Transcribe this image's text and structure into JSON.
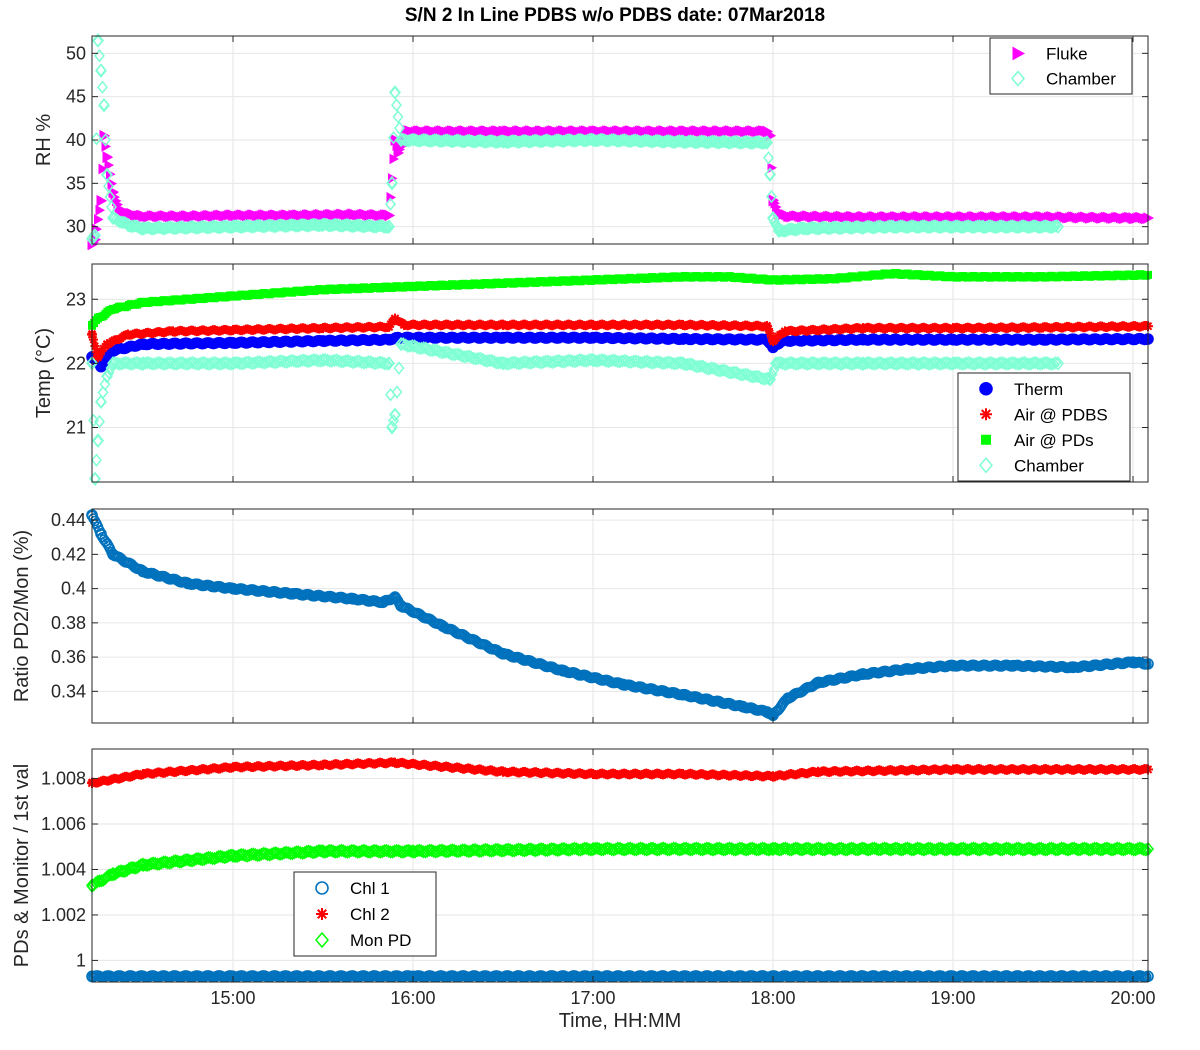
{
  "figure": {
    "title": "S/N 2 In Line PDBS w/o PDBS date: 07Mar2018",
    "xlabel": "Time, HH:MM"
  },
  "colors": {
    "magenta": "#ff00ff",
    "aqua": "#7fffd4",
    "blue": "#0000ff",
    "red": "#ff0000",
    "green": "#00ff00",
    "steelblue": "#0072bd",
    "grid": "#e6e6e6",
    "axis": "#262626"
  },
  "chart_data": [
    {
      "type": "scatter",
      "ylabel": "RH %",
      "ylim": [
        28,
        52
      ],
      "xlim": [
        "14:13",
        "20:05"
      ],
      "y_ticks": [
        30,
        35,
        40,
        45,
        50
      ],
      "grid": true,
      "legend_position": "top-right",
      "series": [
        {
          "name": "Fluke",
          "marker": "triangle-right",
          "color": "magenta",
          "points": [
            [
              "14:13",
              28
            ],
            [
              "14:14",
              28.5
            ],
            [
              "14:16",
              33
            ],
            [
              "14:17",
              40.5
            ],
            [
              "14:18",
              38
            ],
            [
              "14:20",
              34
            ],
            [
              "14:22",
              32
            ],
            [
              "14:25",
              31.5
            ],
            [
              "14:30",
              31.2
            ],
            [
              "14:45",
              31.2
            ],
            [
              "15:00",
              31.3
            ],
            [
              "15:20",
              31.3
            ],
            [
              "15:40",
              31.4
            ],
            [
              "15:52",
              31.3
            ],
            [
              "15:54",
              40
            ],
            [
              "15:55",
              38.5
            ],
            [
              "15:58",
              41
            ],
            [
              "16:30",
              41
            ],
            [
              "17:00",
              41
            ],
            [
              "17:30",
              41
            ],
            [
              "17:58",
              41
            ],
            [
              "17:59",
              40.5
            ],
            [
              "18:00",
              33
            ],
            [
              "18:02",
              31.5
            ],
            [
              "18:05",
              31.2
            ],
            [
              "18:30",
              31.1
            ],
            [
              "19:00",
              31.1
            ],
            [
              "19:30",
              31.1
            ],
            [
              "20:00",
              31
            ],
            [
              "20:05",
              31
            ]
          ]
        },
        {
          "name": "Chamber",
          "marker": "diamond",
          "color": "aqua",
          "points": [
            [
              "14:13",
              28.6
            ],
            [
              "14:14",
              29
            ],
            [
              "14:15",
              51.5
            ],
            [
              "14:16",
              48
            ],
            [
              "14:17",
              44
            ],
            [
              "14:18",
              36
            ],
            [
              "14:20",
              31
            ],
            [
              "14:25",
              30.2
            ],
            [
              "14:30",
              29.8
            ],
            [
              "15:00",
              30
            ],
            [
              "15:30",
              30.2
            ],
            [
              "15:52",
              30
            ],
            [
              "15:53",
              35
            ],
            [
              "15:54",
              45.5
            ],
            [
              "15:56",
              40
            ],
            [
              "16:30",
              39.8
            ],
            [
              "17:00",
              40
            ],
            [
              "17:30",
              39.8
            ],
            [
              "17:58",
              39.7
            ],
            [
              "17:59",
              36
            ],
            [
              "18:00",
              31
            ],
            [
              "18:02",
              29.5
            ],
            [
              "18:10",
              29.8
            ],
            [
              "18:40",
              30
            ],
            [
              "19:10",
              30
            ],
            [
              "19:35",
              30
            ]
          ]
        }
      ]
    },
    {
      "type": "scatter",
      "ylabel": "Temp (°C)",
      "ylim": [
        20.15,
        23.55
      ],
      "xlim": [
        "14:13",
        "20:05"
      ],
      "y_ticks": [
        21,
        22,
        23
      ],
      "grid": true,
      "legend_position": "bottom-right",
      "series": [
        {
          "name": "Therm",
          "marker": "circle-filled",
          "color": "blue",
          "points": [
            [
              "14:13",
              22.1
            ],
            [
              "14:16",
              21.95
            ],
            [
              "14:20",
              22.2
            ],
            [
              "14:30",
              22.3
            ],
            [
              "15:00",
              22.32
            ],
            [
              "15:30",
              22.35
            ],
            [
              "15:52",
              22.37
            ],
            [
              "15:55",
              22.4
            ],
            [
              "16:30",
              22.4
            ],
            [
              "17:00",
              22.4
            ],
            [
              "17:30",
              22.38
            ],
            [
              "17:58",
              22.37
            ],
            [
              "18:00",
              22.25
            ],
            [
              "18:03",
              22.35
            ],
            [
              "18:30",
              22.37
            ],
            [
              "19:00",
              22.37
            ],
            [
              "19:30",
              22.37
            ],
            [
              "20:05",
              22.38
            ]
          ]
        },
        {
          "name": "Air @ PDBS",
          "marker": "asterisk",
          "color": "red",
          "points": [
            [
              "14:13",
              22.45
            ],
            [
              "14:15",
              22.1
            ],
            [
              "14:18",
              22.3
            ],
            [
              "14:25",
              22.45
            ],
            [
              "14:40",
              22.5
            ],
            [
              "15:00",
              22.52
            ],
            [
              "15:30",
              22.55
            ],
            [
              "15:52",
              22.57
            ],
            [
              "15:54",
              22.7
            ],
            [
              "15:57",
              22.6
            ],
            [
              "16:30",
              22.6
            ],
            [
              "17:00",
              22.6
            ],
            [
              "17:30",
              22.6
            ],
            [
              "17:58",
              22.58
            ],
            [
              "18:00",
              22.35
            ],
            [
              "18:04",
              22.5
            ],
            [
              "18:30",
              22.55
            ],
            [
              "19:00",
              22.55
            ],
            [
              "19:30",
              22.56
            ],
            [
              "20:05",
              22.58
            ]
          ]
        },
        {
          "name": "Air @ PDs",
          "marker": "square-filled",
          "color": "green",
          "points": [
            [
              "14:13",
              22.6
            ],
            [
              "14:15",
              22.7
            ],
            [
              "14:20",
              22.85
            ],
            [
              "14:30",
              22.95
            ],
            [
              "15:00",
              23.05
            ],
            [
              "15:30",
              23.15
            ],
            [
              "16:00",
              23.2
            ],
            [
              "16:30",
              23.25
            ],
            [
              "17:00",
              23.3
            ],
            [
              "17:30",
              23.35
            ],
            [
              "17:45",
              23.35
            ],
            [
              "18:00",
              23.3
            ],
            [
              "18:20",
              23.32
            ],
            [
              "18:40",
              23.4
            ],
            [
              "19:00",
              23.35
            ],
            [
              "19:30",
              23.35
            ],
            [
              "20:05",
              23.38
            ]
          ]
        },
        {
          "name": "Chamber",
          "marker": "diamond",
          "color": "aqua",
          "points": [
            [
              "14:13",
              22.0
            ],
            [
              "14:14",
              20.2
            ],
            [
              "14:15",
              20.8
            ],
            [
              "14:16",
              21.4
            ],
            [
              "14:18",
              21.8
            ],
            [
              "14:20",
              22.0
            ],
            [
              "14:30",
              22.0
            ],
            [
              "15:00",
              22.0
            ],
            [
              "15:30",
              22.05
            ],
            [
              "15:52",
              22.0
            ],
            [
              "15:53",
              21.0
            ],
            [
              "15:54",
              21.2
            ],
            [
              "15:56",
              22.3
            ],
            [
              "16:30",
              22.0
            ],
            [
              "17:00",
              22.05
            ],
            [
              "17:30",
              22.0
            ],
            [
              "17:59",
              21.75
            ],
            [
              "18:01",
              22.0
            ],
            [
              "18:30",
              22.0
            ],
            [
              "19:00",
              22.0
            ],
            [
              "19:35",
              22.0
            ]
          ]
        }
      ]
    },
    {
      "type": "scatter",
      "ylabel": "Ratio PD2/Mon (%)",
      "ylim": [
        0.3215,
        0.4465
      ],
      "xlim": [
        "14:13",
        "20:05"
      ],
      "y_ticks": [
        0.34,
        0.36,
        0.38,
        0.4,
        0.42,
        0.44
      ],
      "y_tick_labels": [
        "0.34",
        "0.36",
        "0.38",
        "0.4",
        "0.42",
        "0.44"
      ],
      "grid": true,
      "series": [
        {
          "name": "",
          "marker": "circle",
          "color": "steelblue",
          "points": [
            [
              "14:13",
              0.443
            ],
            [
              "14:16",
              0.432
            ],
            [
              "14:20",
              0.42
            ],
            [
              "14:30",
              0.41
            ],
            [
              "14:45",
              0.403
            ],
            [
              "15:00",
              0.4
            ],
            [
              "15:20",
              0.397
            ],
            [
              "15:40",
              0.394
            ],
            [
              "15:50",
              0.392
            ],
            [
              "15:54",
              0.395
            ],
            [
              "15:56",
              0.39
            ],
            [
              "16:10",
              0.378
            ],
            [
              "16:30",
              0.362
            ],
            [
              "16:50",
              0.352
            ],
            [
              "17:10",
              0.344
            ],
            [
              "17:30",
              0.338
            ],
            [
              "17:50",
              0.331
            ],
            [
              "17:58",
              0.328
            ],
            [
              "18:00",
              0.326
            ],
            [
              "18:05",
              0.336
            ],
            [
              "18:15",
              0.345
            ],
            [
              "18:30",
              0.35
            ],
            [
              "18:45",
              0.353
            ],
            [
              "19:00",
              0.355
            ],
            [
              "19:20",
              0.355
            ],
            [
              "19:40",
              0.354
            ],
            [
              "20:00",
              0.357
            ],
            [
              "20:05",
              0.356
            ]
          ]
        }
      ]
    },
    {
      "type": "scatter",
      "ylabel": "PDs & Monitor / 1st val",
      "ylim": [
        0.99905,
        1.0093
      ],
      "xlim": [
        "14:13",
        "20:05"
      ],
      "y_ticks": [
        1.0,
        1.002,
        1.004,
        1.006,
        1.008
      ],
      "y_tick_labels": [
        "1",
        "1.002",
        "1.004",
        "1.006",
        "1.008"
      ],
      "grid": true,
      "legend_position": "bottom-left",
      "series": [
        {
          "name": "Chl 1",
          "marker": "circle",
          "color": "steelblue",
          "points": [
            [
              "14:13",
              0.9993
            ],
            [
              "15:00",
              0.9993
            ],
            [
              "16:00",
              0.9993
            ],
            [
              "17:00",
              0.9993
            ],
            [
              "18:00",
              0.9993
            ],
            [
              "19:00",
              0.9993
            ],
            [
              "20:05",
              0.9993
            ]
          ]
        },
        {
          "name": "Chl 2",
          "marker": "asterisk",
          "color": "red",
          "points": [
            [
              "14:13",
              1.0078
            ],
            [
              "14:30",
              1.0082
            ],
            [
              "15:00",
              1.0085
            ],
            [
              "15:30",
              1.0086
            ],
            [
              "15:54",
              1.0087
            ],
            [
              "16:30",
              1.0083
            ],
            [
              "17:00",
              1.0082
            ],
            [
              "17:30",
              1.0082
            ],
            [
              "18:00",
              1.0081
            ],
            [
              "18:15",
              1.0083
            ],
            [
              "19:00",
              1.0084
            ],
            [
              "20:05",
              1.0084
            ]
          ]
        },
        {
          "name": "Mon PD",
          "marker": "diamond",
          "color": "green",
          "points": [
            [
              "14:13",
              1.0033
            ],
            [
              "14:20",
              1.0038
            ],
            [
              "14:30",
              1.0042
            ],
            [
              "15:00",
              1.0046
            ],
            [
              "15:30",
              1.0048
            ],
            [
              "16:00",
              1.0048
            ],
            [
              "17:00",
              1.0049
            ],
            [
              "18:00",
              1.0049
            ],
            [
              "19:00",
              1.0049
            ],
            [
              "20:05",
              1.0049
            ]
          ]
        }
      ]
    }
  ],
  "x_ticks": [
    "15:00",
    "16:00",
    "17:00",
    "18:00",
    "19:00",
    "20:00"
  ]
}
